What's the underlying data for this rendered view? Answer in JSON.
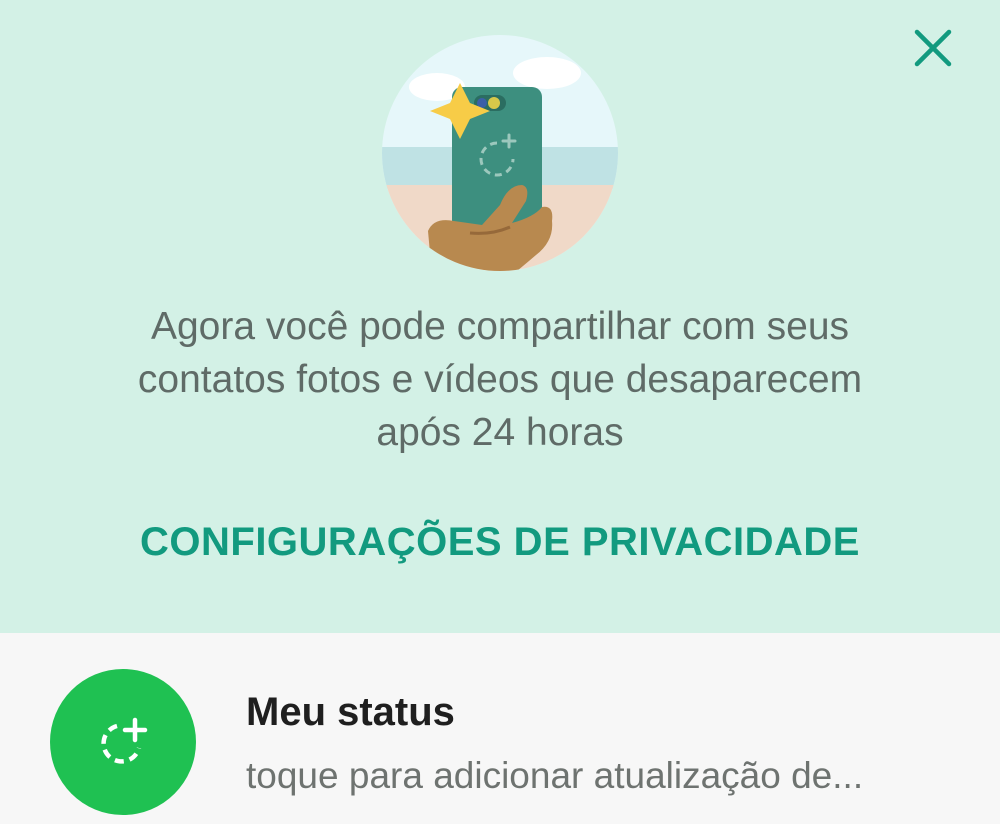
{
  "banner": {
    "message_line1": "Agora você pode compartilhar com seus",
    "message_line2": "contatos fotos e vídeos que desaparecem",
    "message_line3": "após 24 horas",
    "privacy_link": "CONFIGURAÇÕES DE PRIVACIDADE",
    "close_icon": "close-icon",
    "accent_color": "#129a7f",
    "background_color": "#d3f1e6"
  },
  "my_status": {
    "title": "Meu status",
    "subtitle": "toque para adicionar atualização de...",
    "avatar_icon": "status-add-icon",
    "avatar_color": "#1fc152"
  }
}
